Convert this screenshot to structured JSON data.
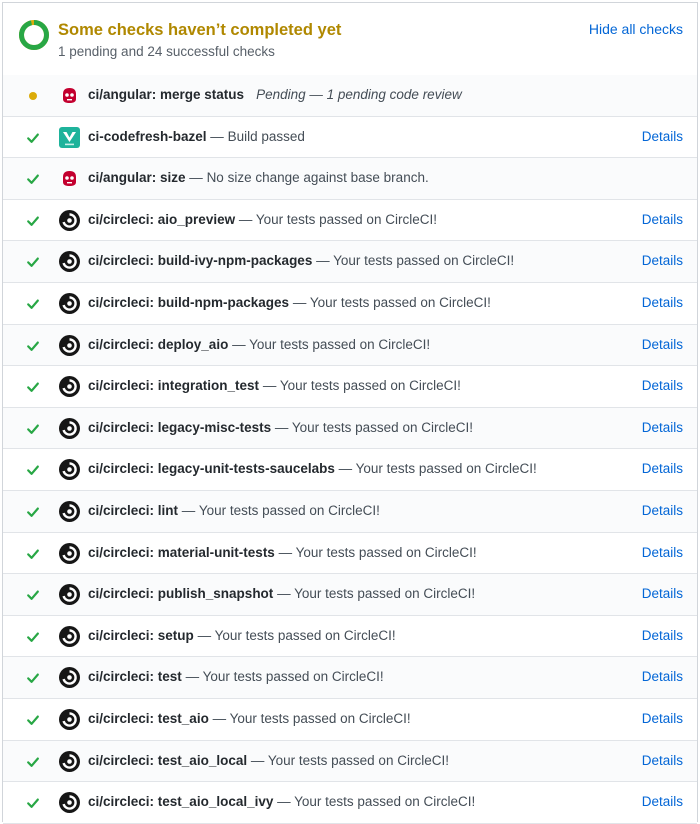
{
  "header": {
    "title": "Some checks haven’t completed yet",
    "subtitle": "1 pending and 24 successful checks",
    "hide_label": "Hide all checks",
    "progress_successful_fraction": 0.96
  },
  "colors": {
    "success": "#28a745",
    "pending": "#dbab09",
    "link": "#0366d6",
    "title": "#b08800"
  },
  "checks": [
    {
      "status": "pending",
      "icon": "angular-icon",
      "name": "ci/angular: merge status",
      "desc": "Pending — 1 pending code review",
      "sep": "",
      "details": ""
    },
    {
      "status": "success",
      "icon": "codefresh-icon",
      "name": "ci-codefresh-bazel",
      "sep": " — ",
      "desc": "Build passed",
      "details": "Details"
    },
    {
      "status": "success",
      "icon": "angular-icon",
      "name": "ci/angular: size",
      "sep": " — ",
      "desc": "No size change against base branch.",
      "details": ""
    },
    {
      "status": "success",
      "icon": "circleci-icon",
      "name": "ci/circleci: aio_preview",
      "sep": " — ",
      "desc": "Your tests passed on CircleCI!",
      "details": "Details"
    },
    {
      "status": "success",
      "icon": "circleci-icon",
      "name": "ci/circleci: build-ivy-npm-packages",
      "sep": " — ",
      "desc": "Your tests passed on CircleCI!",
      "details": "Details"
    },
    {
      "status": "success",
      "icon": "circleci-icon",
      "name": "ci/circleci: build-npm-packages",
      "sep": " — ",
      "desc": "Your tests passed on CircleCI!",
      "details": "Details"
    },
    {
      "status": "success",
      "icon": "circleci-icon",
      "name": "ci/circleci: deploy_aio",
      "sep": " — ",
      "desc": "Your tests passed on CircleCI!",
      "details": "Details"
    },
    {
      "status": "success",
      "icon": "circleci-icon",
      "name": "ci/circleci: integration_test",
      "sep": " — ",
      "desc": "Your tests passed on CircleCI!",
      "details": "Details"
    },
    {
      "status": "success",
      "icon": "circleci-icon",
      "name": "ci/circleci: legacy-misc-tests",
      "sep": " — ",
      "desc": "Your tests passed on CircleCI!",
      "details": "Details"
    },
    {
      "status": "success",
      "icon": "circleci-icon",
      "name": "ci/circleci: legacy-unit-tests-saucelabs",
      "sep": " — ",
      "desc": "Your tests passed on CircleCI!",
      "details": "Details"
    },
    {
      "status": "success",
      "icon": "circleci-icon",
      "name": "ci/circleci: lint",
      "sep": " — ",
      "desc": "Your tests passed on CircleCI!",
      "details": "Details"
    },
    {
      "status": "success",
      "icon": "circleci-icon",
      "name": "ci/circleci: material-unit-tests",
      "sep": " — ",
      "desc": "Your tests passed on CircleCI!",
      "details": "Details"
    },
    {
      "status": "success",
      "icon": "circleci-icon",
      "name": "ci/circleci: publish_snapshot",
      "sep": " — ",
      "desc": "Your tests passed on CircleCI!",
      "details": "Details"
    },
    {
      "status": "success",
      "icon": "circleci-icon",
      "name": "ci/circleci: setup",
      "sep": " — ",
      "desc": "Your tests passed on CircleCI!",
      "details": "Details"
    },
    {
      "status": "success",
      "icon": "circleci-icon",
      "name": "ci/circleci: test",
      "sep": " — ",
      "desc": "Your tests passed on CircleCI!",
      "details": "Details"
    },
    {
      "status": "success",
      "icon": "circleci-icon",
      "name": "ci/circleci: test_aio",
      "sep": " — ",
      "desc": "Your tests passed on CircleCI!",
      "details": "Details"
    },
    {
      "status": "success",
      "icon": "circleci-icon",
      "name": "ci/circleci: test_aio_local",
      "sep": " — ",
      "desc": "Your tests passed on CircleCI!",
      "details": "Details"
    },
    {
      "status": "success",
      "icon": "circleci-icon",
      "name": "ci/circleci: test_aio_local_ivy",
      "sep": " — ",
      "desc": "Your tests passed on CircleCI!",
      "details": "Details"
    }
  ]
}
